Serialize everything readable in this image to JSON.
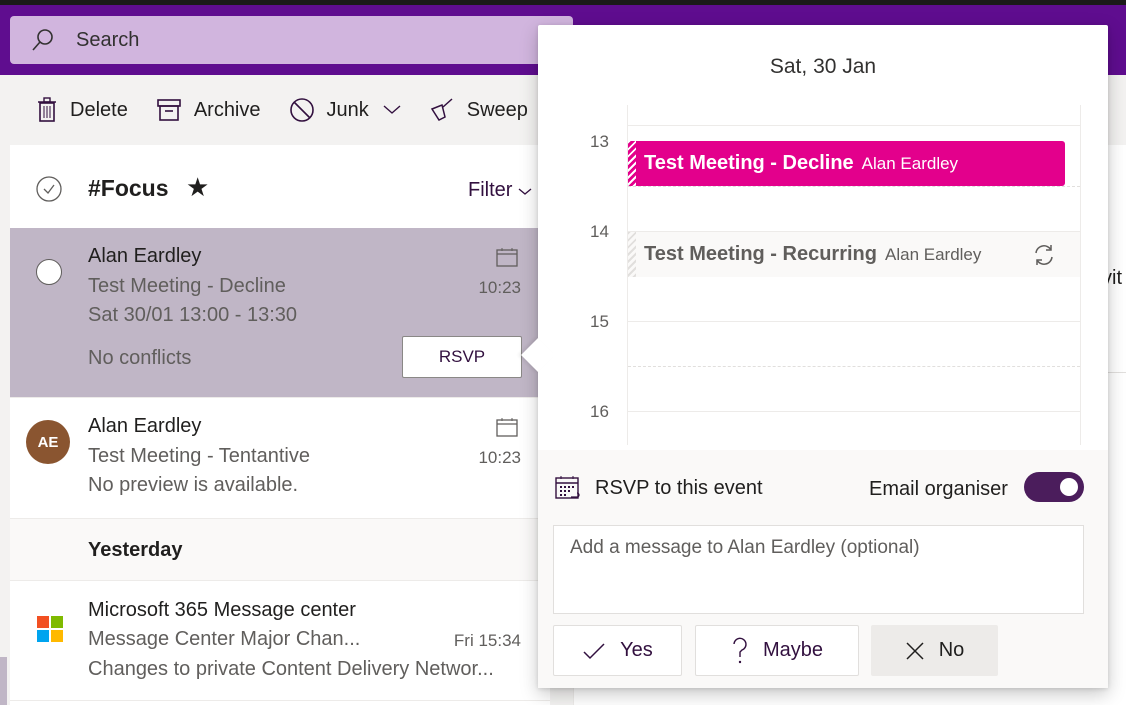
{
  "header": {
    "search_placeholder": "Search"
  },
  "toolbar": {
    "delete": "Delete",
    "archive": "Archive",
    "junk": "Junk",
    "sweep": "Sweep"
  },
  "list": {
    "folder_title": "#Focus",
    "filter_label": "Filter",
    "items": [
      {
        "sender": "Alan Eardley",
        "subject": "Test Meeting - Decline",
        "detail": "Sat 30/01 13:00 - 13:30",
        "status": "No conflicts",
        "time": "10:23",
        "action": "RSVP"
      },
      {
        "initials": "AE",
        "sender": "Alan Eardley",
        "subject": "Test Meeting - Tentantive",
        "preview": "No preview is available.",
        "time": "10:23"
      }
    ],
    "group_label": "Yesterday",
    "items_yesterday": [
      {
        "sender": "Microsoft 365 Message center",
        "subject": "Message Center Major Chan...",
        "preview": "Changes to private Content Delivery Networ...",
        "time": "Fri 15:34"
      }
    ]
  },
  "reading_pane": {
    "fragment": "vit"
  },
  "popup": {
    "date": "Sat, 30 Jan",
    "hours": [
      "13",
      "14",
      "15",
      "16"
    ],
    "events": [
      {
        "title": "Test Meeting - Decline",
        "organizer": "Alan Eardley",
        "color": "#e3008c"
      },
      {
        "title": "Test Meeting - Recurring",
        "organizer": "Alan Eardley",
        "recurring": true
      }
    ],
    "rsvp_heading": "RSVP to this event",
    "email_organiser_label": "Email organiser",
    "email_organiser_on": true,
    "message_placeholder": "Add a message to Alan Eardley (optional)",
    "buttons": {
      "yes": "Yes",
      "maybe": "Maybe",
      "no": "No"
    }
  },
  "colors": {
    "brand": "#5f0d8f",
    "accent": "#4b1d5c",
    "event": "#e3008c",
    "selected_row": "#c0b6c6"
  }
}
